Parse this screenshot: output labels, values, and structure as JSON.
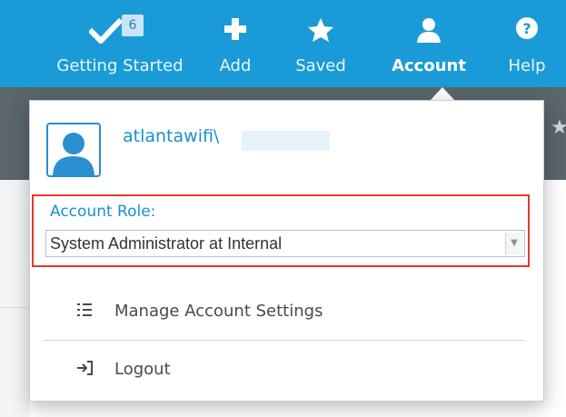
{
  "nav": {
    "getting_started_badge": "6",
    "getting_started": "Getting Started",
    "add": "Add",
    "saved": "Saved",
    "account": "Account",
    "help": "Help"
  },
  "account_menu": {
    "username": "atlantawifi\\",
    "role_label": "Account Role:",
    "role_value": "System Administrator at Internal",
    "manage_settings": "Manage Account Settings",
    "logout": "Logout"
  },
  "colors": {
    "topbar": "#1a9bd7",
    "accent": "#1a8fd0",
    "highlight_border": "#e03b2d"
  },
  "icons": {
    "getting_started": "checkmark-icon",
    "add": "plus-icon",
    "saved": "star-icon",
    "account": "user-icon",
    "help": "question-icon",
    "manage_settings": "list-icon",
    "logout": "logout-icon"
  }
}
